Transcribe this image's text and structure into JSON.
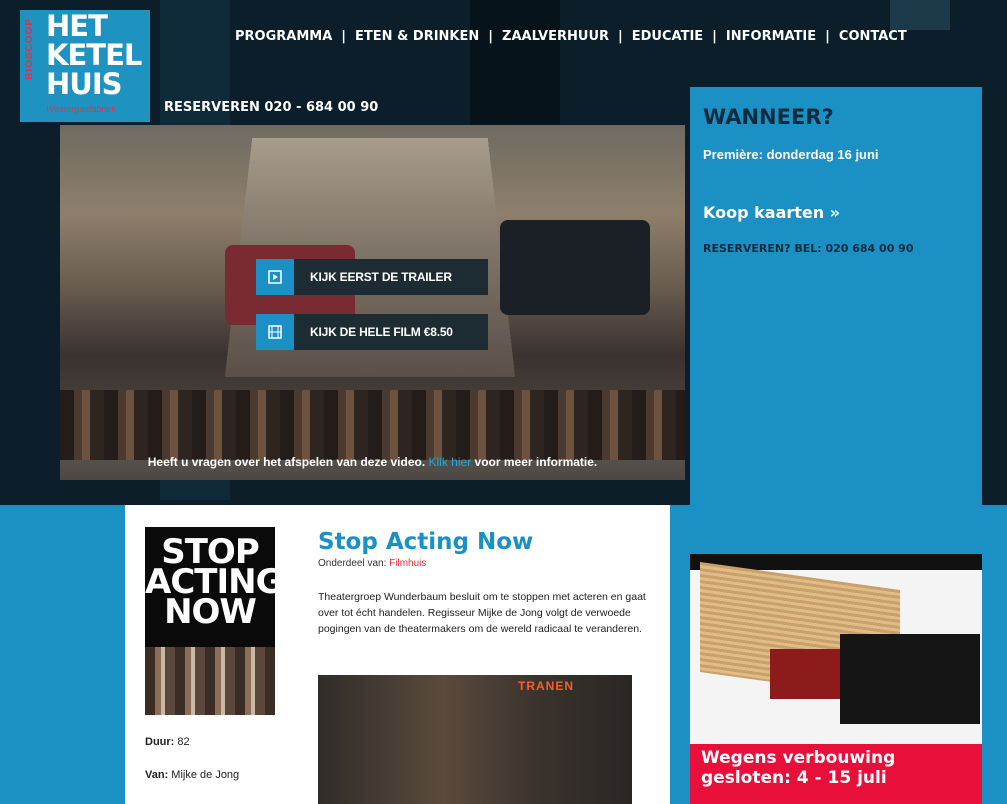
{
  "header": {
    "logo": {
      "line1": "HET",
      "line2": "KETEL",
      "line3": "HUIS",
      "side": "BIOSCOOP",
      "sub": "Westergasfabriek"
    },
    "nav": [
      "PROGRAMMA",
      "ETEN & DRINKEN",
      "ZAALVERHUUR",
      "EDUCATIE",
      "INFORMATIE",
      "CONTACT"
    ],
    "nav_separator": "|",
    "reserve": "RESERVEREN 020 - 684 00 90"
  },
  "video": {
    "trailer_button": "KIJK EERST DE TRAILER",
    "film_button": "KIJK DE HELE FILM €8.50",
    "note_before": "Heeft u vragen over het afspelen van deze video.",
    "note_link": "Klik hier",
    "note_after": "voor meer informatie."
  },
  "sidebar": {
    "heading": "WANNEER?",
    "premiere": "Première: donderdag 16 juni",
    "buy": "Koop kaarten »",
    "call": "RESERVEREN?  BEL: 020 684 00 90"
  },
  "film": {
    "poster_title": "STOP ACTING NOW",
    "title": "Stop Acting Now",
    "part_of_label": "Onderdeel van:",
    "part_of_link": "Filmhuis",
    "description": "Theatergroep Wunderbaum besluit om te stoppen met acteren en gaat over tot écht handelen. Regisseur Mijke de Jong volgt de verwoede pogingen van de theatermakers om de wereld radicaal te veranderen.",
    "still_sign": "TRANEN",
    "duration_label": "Duur:",
    "duration_value": "82",
    "director_label": "Van:",
    "director_value": "Mijke de Jong"
  },
  "ad": {
    "line1": "Wegens verbouwing",
    "line2": "gesloten: 4 - 15 juli"
  },
  "colors": {
    "accent_blue": "#1a90c4",
    "dark_bg": "#0b1e29",
    "red": "#e8103a"
  }
}
